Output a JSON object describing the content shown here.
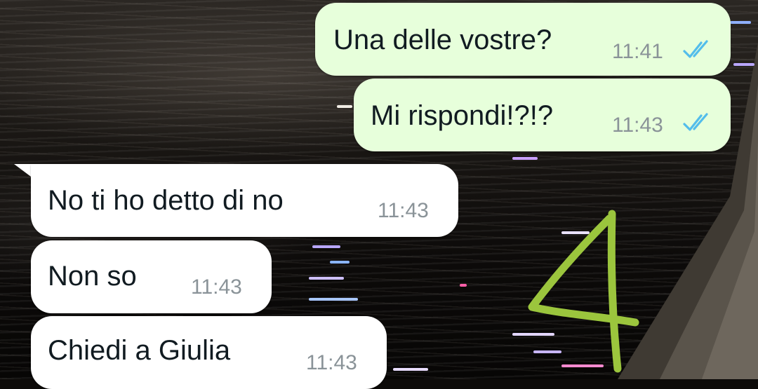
{
  "chat": {
    "messages": [
      {
        "direction": "outgoing",
        "text": "Una delle vostre?",
        "time": "11:41",
        "status": "read",
        "status_icon": "double-check-icon"
      },
      {
        "direction": "outgoing",
        "text": "Mi rispondi!?!?",
        "time": "11:43",
        "status": "read",
        "status_icon": "double-check-icon"
      },
      {
        "direction": "incoming",
        "text": "No ti ho detto di no",
        "time": "11:43"
      },
      {
        "direction": "incoming",
        "text": "Non so",
        "time": "11:43"
      },
      {
        "direction": "incoming",
        "text": "Chiedi a Giulia",
        "time": "11:43"
      }
    ]
  },
  "annotation": {
    "text": "4",
    "color": "#9bc53d"
  },
  "colors": {
    "outgoing_bubble": "#e7ffdb",
    "incoming_bubble": "#ffffff",
    "read_ticks": "#53bdeb",
    "timestamp": "#8a9398",
    "message_text": "#111b21"
  }
}
